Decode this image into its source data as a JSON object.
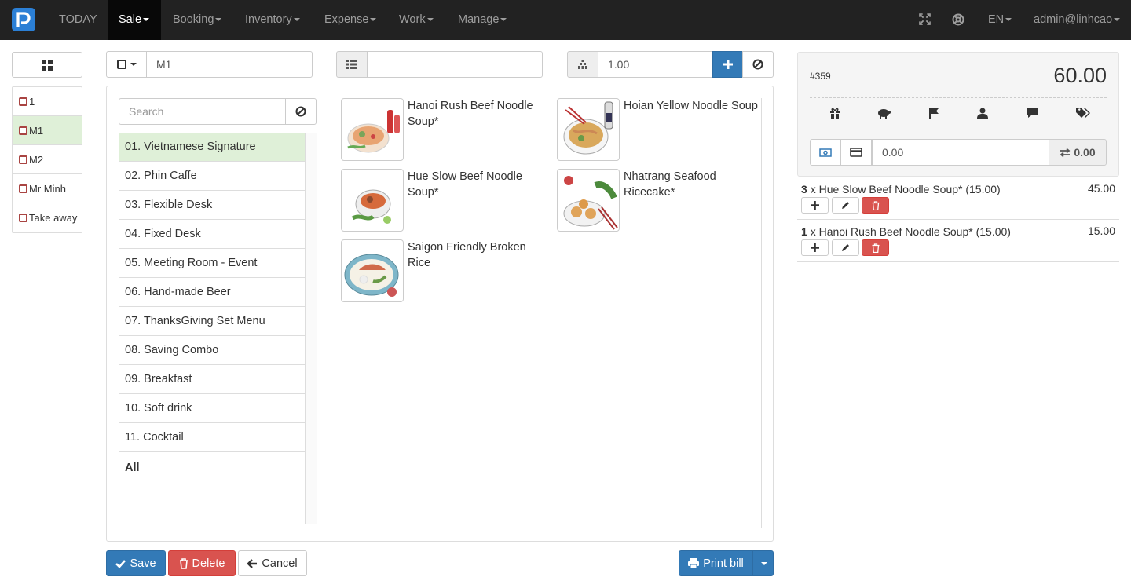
{
  "nav": {
    "today": "TODAY",
    "menus": [
      "Sale",
      "Booking",
      "Inventory",
      "Expense",
      "Work",
      "Manage"
    ],
    "language": "EN",
    "user": "admin@linhcao"
  },
  "toolbar": {
    "table_value": "M1",
    "list_value": "",
    "quantity_value": "1.00"
  },
  "tables": [
    "1",
    "M1",
    "M2",
    "Mr Minh",
    "Take away"
  ],
  "search": {
    "placeholder": "Search"
  },
  "categories": [
    "01. Vietnamese Signature",
    "02. Phin Caffe",
    "03. Flexible Desk",
    "04. Fixed Desk",
    "05. Meeting Room - Event",
    "06. Hand-made Beer",
    "07. ThanksGiving Set Menu",
    "08. Saving Combo",
    "09. Breakfast",
    "10. Soft drink",
    "11. Cocktail",
    "All"
  ],
  "products": [
    {
      "name": "Hanoi Rush Beef Noodle Soup*"
    },
    {
      "name": "Hoian Yellow Noodle Soup"
    },
    {
      "name": "Hue Slow Beef Noodle Soup*"
    },
    {
      "name": "Nhatrang Seafood Ricecake*"
    },
    {
      "name": "Saigon Friendly Broken Rice"
    }
  ],
  "bill": {
    "number": "#359",
    "total": "60.00",
    "payment_value": "0.00",
    "change": "0.00"
  },
  "order_lines": [
    {
      "qty": "3",
      "text": "x Hue Slow Beef Noodle Soup* (15.00)",
      "amount": "45.00"
    },
    {
      "qty": "1",
      "text": "x Hanoi Rush Beef Noodle Soup* (15.00)",
      "amount": "15.00"
    }
  ],
  "buttons": {
    "save": "Save",
    "delete": "Delete",
    "cancel": "Cancel",
    "print": "Print bill"
  },
  "colors": {
    "primary": "#337ab7",
    "danger": "#d9534f",
    "success_bg": "#dff0d8",
    "navbar": "#222222"
  }
}
